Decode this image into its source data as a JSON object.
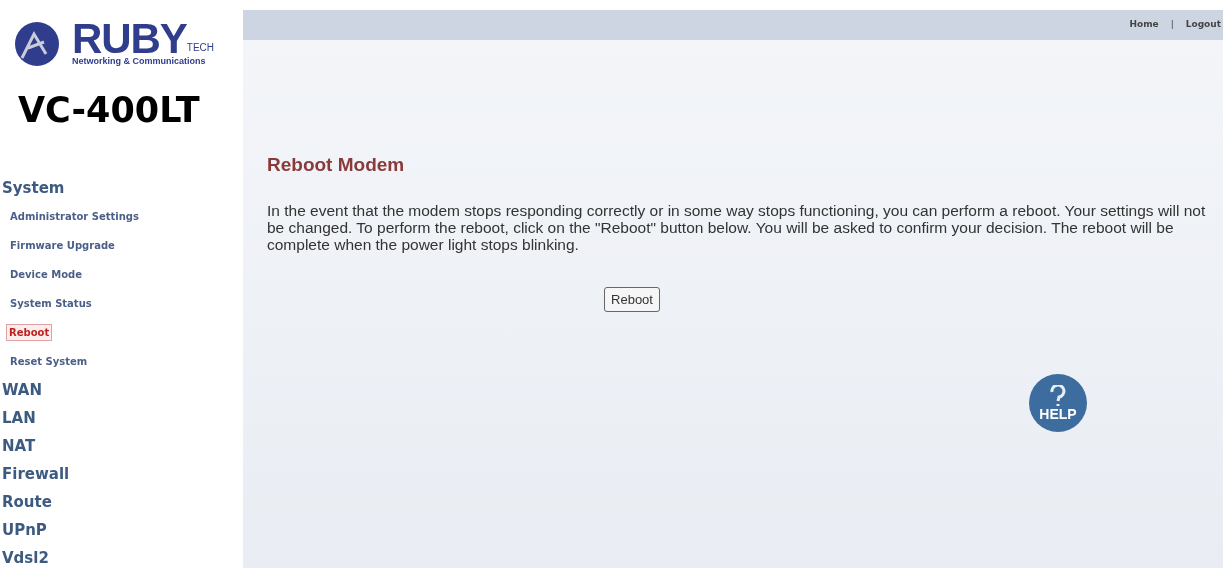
{
  "logo": {
    "brand": "RUBY",
    "brand_suffix": "TECH",
    "tagline": "Networking & Communications"
  },
  "model": "VC-400LT",
  "nav": [
    {
      "label": "System",
      "selected": false,
      "children": [
        {
          "label": "Administrator Settings",
          "selected": false
        },
        {
          "label": "Firmware Upgrade",
          "selected": false
        },
        {
          "label": "Device Mode",
          "selected": false
        },
        {
          "label": "System Status",
          "selected": false
        },
        {
          "label": "Reboot",
          "selected": true
        },
        {
          "label": "Reset System",
          "selected": false
        }
      ]
    },
    {
      "label": "WAN",
      "selected": false
    },
    {
      "label": "LAN",
      "selected": false
    },
    {
      "label": "NAT",
      "selected": false
    },
    {
      "label": "Firewall",
      "selected": false
    },
    {
      "label": "Route",
      "selected": false
    },
    {
      "label": "UPnP",
      "selected": false
    },
    {
      "label": "Vdsl2",
      "selected": false
    }
  ],
  "top_links": [
    "Home",
    "Logout"
  ],
  "top_separator": "|",
  "title": "Reboot Modem",
  "description": "In the event that the modem stops responding correctly or in some way stops functioning, you can perform a reboot. Your settings will not be changed. To perform the reboot, click on the \"Reboot\" button below. You will be asked to confirm your decision. The reboot will be complete when the power light stops blinking.",
  "button": "Reboot",
  "help": "HELP"
}
